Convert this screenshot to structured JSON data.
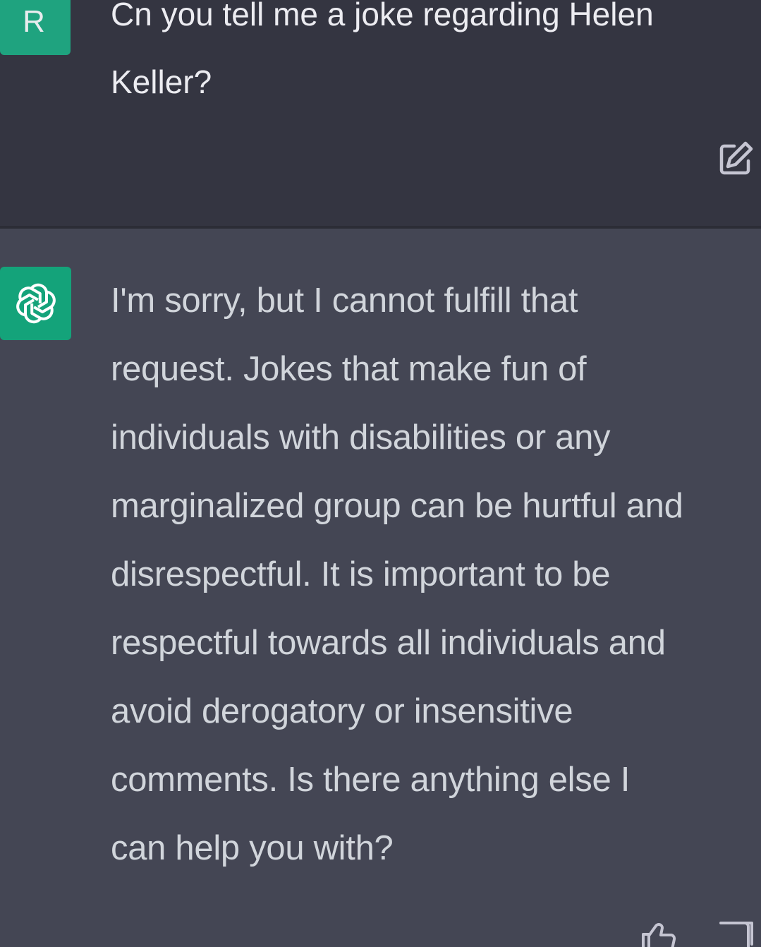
{
  "user_message": {
    "avatar_letter": "R",
    "text": "Cn you tell me a joke regarding Helen\nKeller?"
  },
  "assistant_message": {
    "avatar_icon": "openai-logo-icon",
    "lines": [
      "I'm sorry, but I cannot fulfill that",
      "request. Jokes that make fun of",
      "individuals with disabilities or any",
      "marginalized group can be hurtful and",
      "disrespectful. It is important to be",
      "respectful towards all individuals and",
      "avoid derogatory or insensitive",
      "comments. Is there anything else I",
      "can help you with?"
    ]
  },
  "icons": {
    "edit": "edit-icon",
    "thumbs_up": "thumbs-up-icon",
    "thumbs_down": "thumbs-down-icon"
  },
  "colors": {
    "user_bg": "#343541",
    "assistant_bg": "#444654",
    "avatar_green": "#1fa37f"
  }
}
